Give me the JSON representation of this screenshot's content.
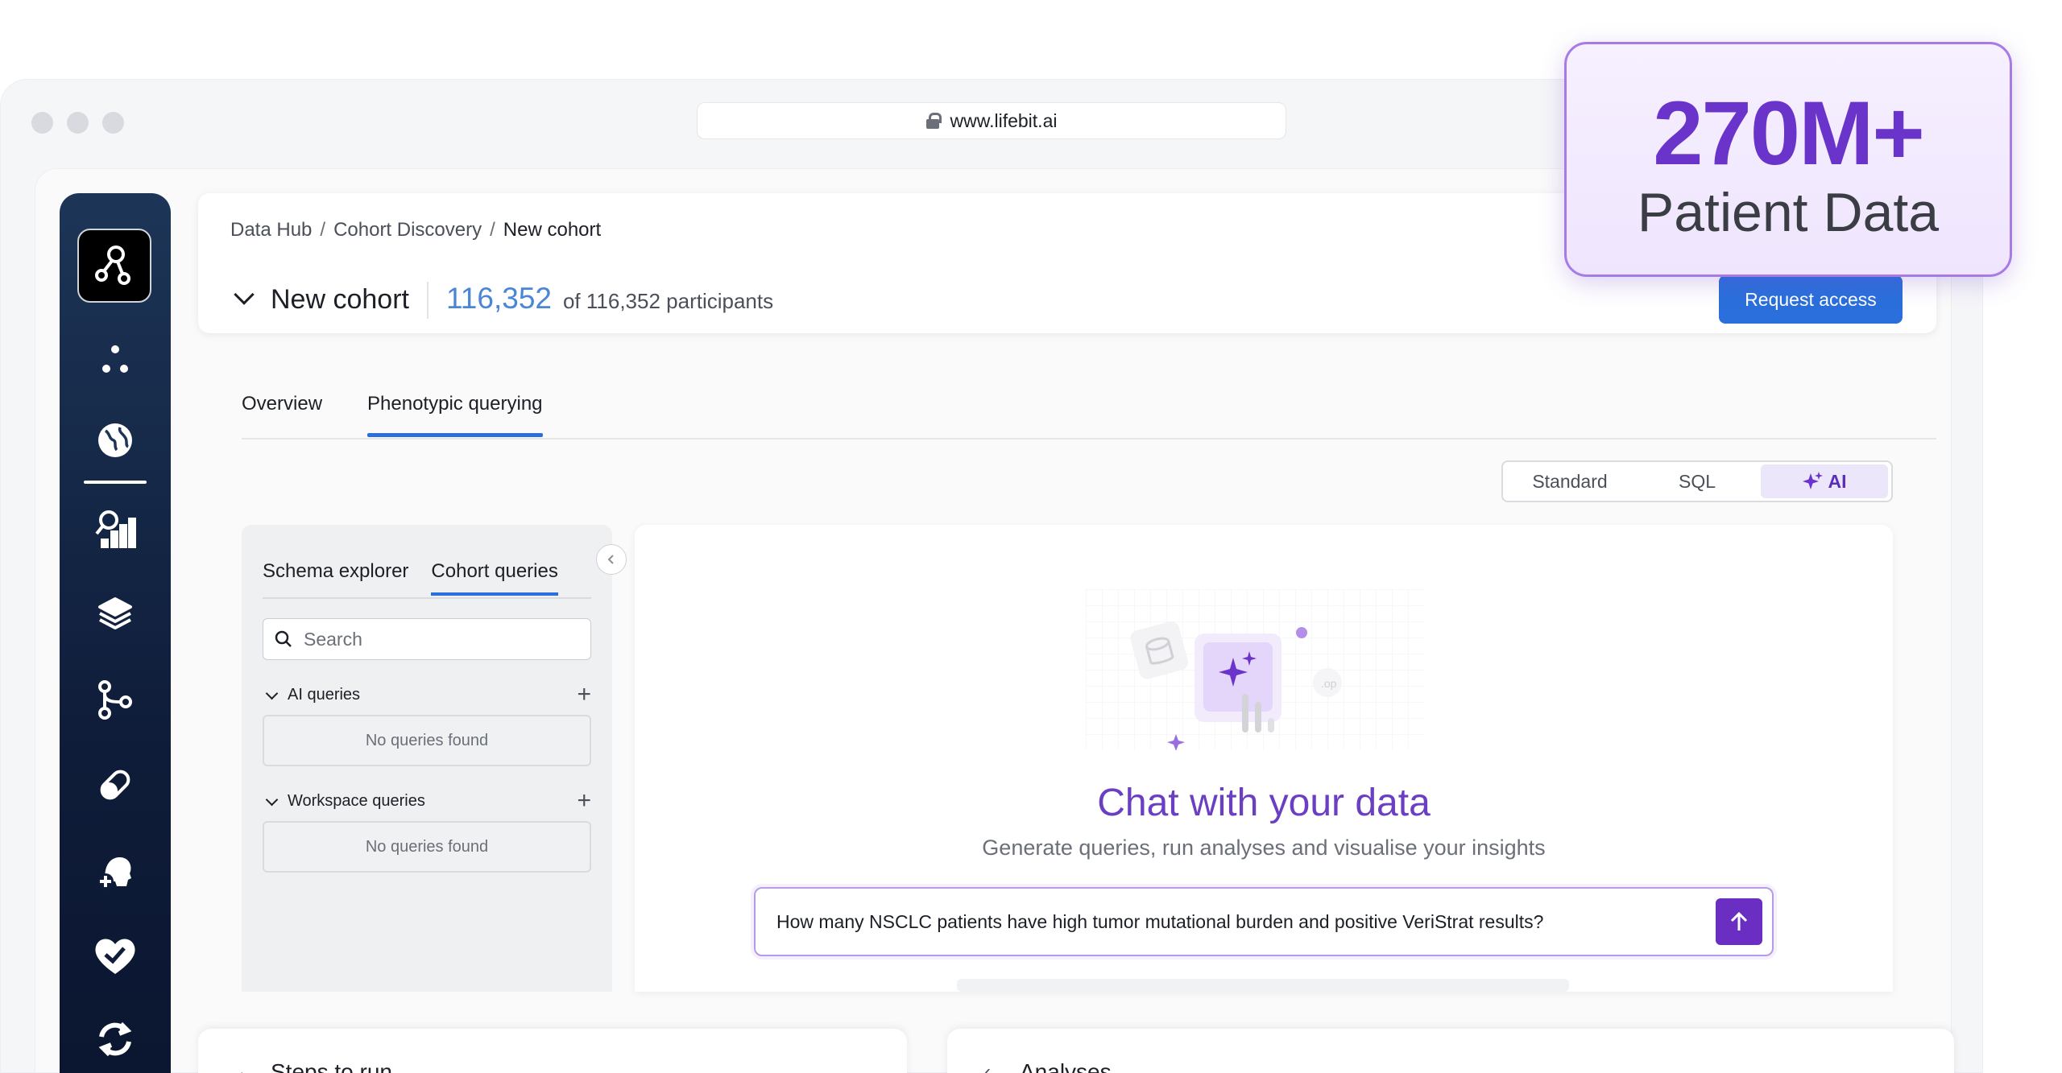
{
  "browser": {
    "url": "www.lifebit.ai"
  },
  "sidebar": {
    "items": [
      {
        "icon": "logo-icon"
      },
      {
        "icon": "dots-cluster-icon"
      },
      {
        "icon": "globe-icon"
      },
      {
        "icon": "analytics-icon"
      },
      {
        "icon": "layers-icon"
      },
      {
        "icon": "git-branch-icon"
      },
      {
        "icon": "pill-icon"
      },
      {
        "icon": "add-patient-icon"
      },
      {
        "icon": "heart-icon"
      },
      {
        "icon": "sync-icon"
      }
    ]
  },
  "breadcrumb": {
    "item1": "Data Hub",
    "sep": "/",
    "item2": "Cohort Discovery",
    "item3": "New cohort"
  },
  "cohort": {
    "title": "New cohort",
    "count": "116,352",
    "subtitle": "of 116,352 participants"
  },
  "header": {
    "request_label": "Request access"
  },
  "tabs": [
    {
      "label": "Overview"
    },
    {
      "label": "Phenotypic querying"
    }
  ],
  "modes": [
    {
      "label": "Standard"
    },
    {
      "label": "SQL"
    },
    {
      "label": "AI"
    }
  ],
  "panel": {
    "tabs": [
      {
        "label": "Schema explorer"
      },
      {
        "label": "Cohort queries"
      }
    ],
    "search_placeholder": "Search",
    "sections": [
      {
        "label": "AI queries",
        "empty": "No queries found"
      },
      {
        "label": "Workspace queries",
        "empty": "No queries found"
      }
    ]
  },
  "chat": {
    "title": "Chat with your data",
    "subtitle": "Generate queries, run analyses and visualise your insights",
    "prompt": "How many NSCLC patients have high tumor mutational burden and positive VeriStrat results?"
  },
  "bottom": {
    "steps_label": "Steps to run",
    "analyses_label": "Analyses"
  },
  "badge": {
    "value": "270M+",
    "label": "Patient Data"
  },
  "colors": {
    "accent": "#2a6fdb",
    "ai_purple": "#6a3fc2",
    "sidebar": "#1d3557",
    "badge_border": "#a77be6"
  }
}
